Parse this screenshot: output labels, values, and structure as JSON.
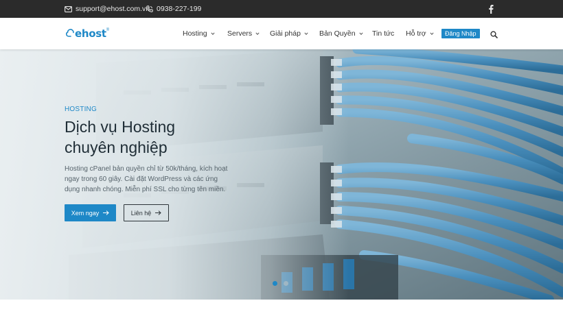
{
  "topbar": {
    "email": "support@ehost.com.vn",
    "phone": "0938-227-199",
    "icons": {
      "email": "mail-icon",
      "phone": "phone-icon",
      "social": "facebook-icon"
    }
  },
  "brand": {
    "logo_text": "ehost",
    "registered_mark": "®",
    "primary_color": "#1e88c7"
  },
  "nav": {
    "items": [
      {
        "label": "Hosting",
        "has_dropdown": true
      },
      {
        "label": "Servers",
        "has_dropdown": true
      },
      {
        "label": "Giải pháp",
        "has_dropdown": true
      },
      {
        "label": "Bản Quyền",
        "has_dropdown": true
      },
      {
        "label": "Tin tức",
        "has_dropdown": false
      },
      {
        "label": "Hỗ trợ",
        "has_dropdown": true
      }
    ],
    "login_label": "Đăng Nhập",
    "search_icon": "search-icon"
  },
  "hero": {
    "eyebrow": "HOSTING",
    "title_line1": "Dịch vụ Hosting",
    "title_line2": "chuyên nghiệp",
    "description": "Hosting cPanel bản quyền chỉ từ 50k/tháng, kích hoạt ngay trong 60 giây. Cài đặt WordPress và các ứng dụng nhanh chóng. Miễn phí SSL cho từng tên miền.",
    "primary_cta": "Xem ngay",
    "secondary_cta": "Liên hệ",
    "slide_count": 2,
    "active_slide": 1
  }
}
